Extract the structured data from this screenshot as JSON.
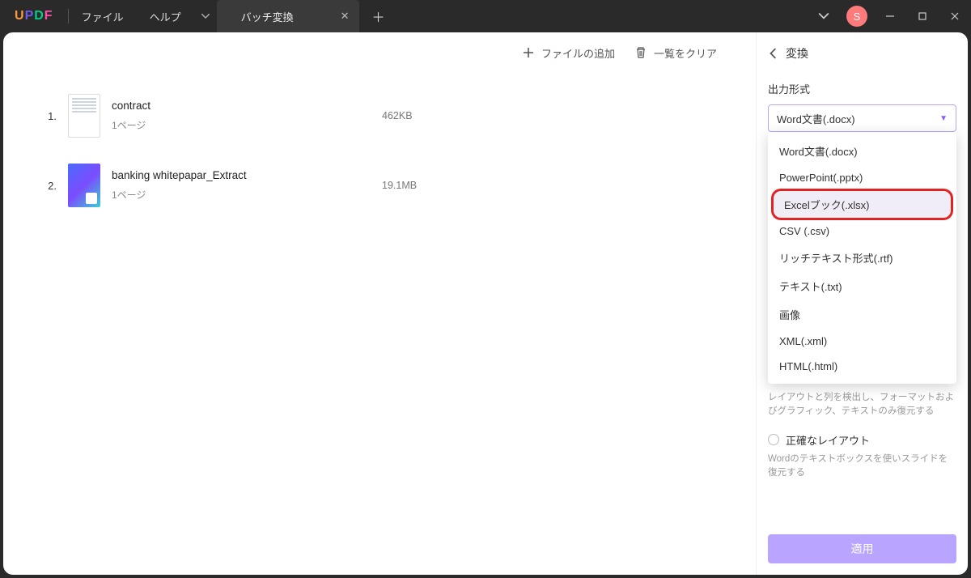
{
  "titlebar": {
    "logo_letters": [
      "U",
      "P",
      "D",
      "F"
    ],
    "menu_file": "ファイル",
    "menu_help": "ヘルプ",
    "tab_title": "バッチ変換",
    "avatar_initial": "S"
  },
  "toolbar": {
    "add_files": "ファイルの追加",
    "clear_list": "一覧をクリア"
  },
  "files": [
    {
      "idx": "1.",
      "name": "contract",
      "pages": "1ページ",
      "size": "462KB"
    },
    {
      "idx": "2.",
      "name": "banking whitepapar_Extract",
      "pages": "1ページ",
      "size": "19.1MB"
    }
  ],
  "panel": {
    "back_label": "変換",
    "format_label": "出力形式",
    "selected_format": "Word文書(.docx)",
    "options": [
      "Word文書(.docx)",
      "PowerPoint(.pptx)",
      "Excelブック(.xlsx)",
      "CSV (.csv)",
      "リッチテキスト形式(.rtf)",
      "テキスト(.txt)",
      "画像",
      "XML(.xml)",
      "HTML(.html)"
    ],
    "highlighted_index": 2,
    "hint1": "レイアウトと列を検出し、フォーマットおよびグラフィック、テキストのみ復元する",
    "radio_label": "正確なレイアウト",
    "hint2": "Wordのテキストボックスを使いスライドを復元する",
    "apply": "適用"
  }
}
